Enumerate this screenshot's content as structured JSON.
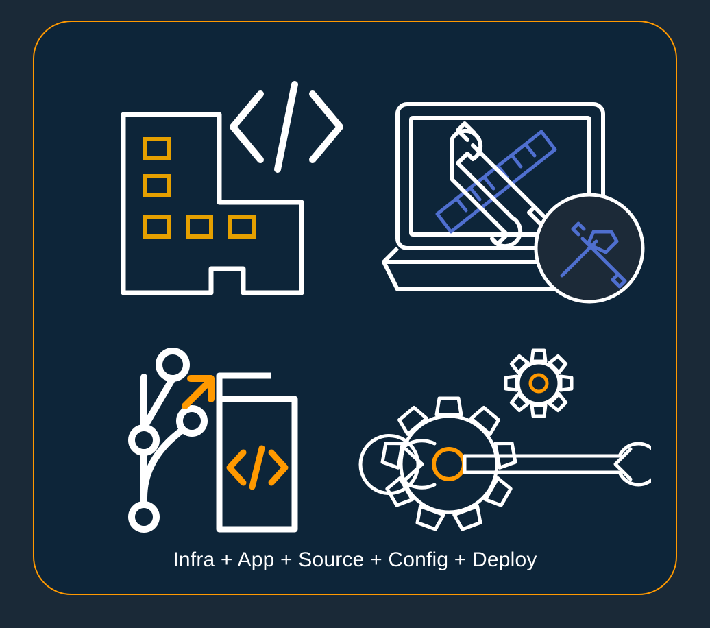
{
  "caption": "Infra + App + Source + Config + Deploy",
  "colors": {
    "bg_page": "#1a2937",
    "bg_panel": "#0d2539",
    "accent_orange": "#ff9900",
    "accent_amber": "#e5a000",
    "accent_blue": "#4f6fcf",
    "line_white": "#ffffff"
  },
  "icons": {
    "top_left": "building-code-icon",
    "top_right": "laptop-tools-icon",
    "bottom_left": "source-branch-icon",
    "bottom_right": "gears-wrench-icon"
  }
}
